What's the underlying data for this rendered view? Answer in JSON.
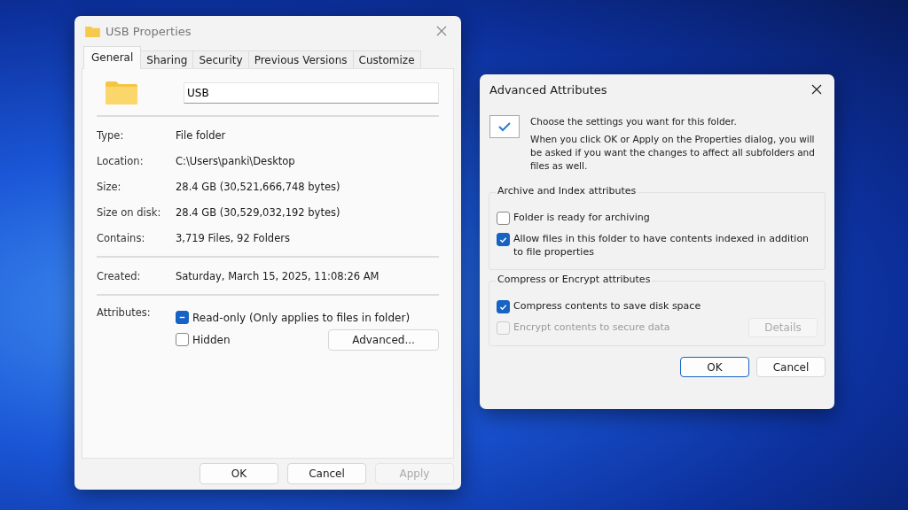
{
  "properties_window": {
    "title": "USB Properties",
    "tabs": [
      {
        "label": "General",
        "selected": true
      },
      {
        "label": "Sharing",
        "selected": false
      },
      {
        "label": "Security",
        "selected": false
      },
      {
        "label": "Previous Versions",
        "selected": false
      },
      {
        "label": "Customize",
        "selected": false
      }
    ],
    "name_field": {
      "value": "USB"
    },
    "info_groups": [
      [
        {
          "label": "Type:",
          "value": "File folder"
        },
        {
          "label": "Location:",
          "value": "C:\\Users\\panki\\Desktop"
        },
        {
          "label": "Size:",
          "value": "28.4 GB (30,521,666,748 bytes)"
        },
        {
          "label": "Size on disk:",
          "value": "28.4 GB (30,529,032,192 bytes)"
        },
        {
          "label": "Contains:",
          "value": "3,719 Files, 92 Folders"
        }
      ],
      [
        {
          "label": "Created:",
          "value": "Saturday, March 15, 2025, 11:08:26 AM"
        }
      ]
    ],
    "attributes": {
      "label": "Attributes:",
      "options": [
        {
          "label": "Read-only (Only applies to files in folder)",
          "checked": true,
          "mixed": true
        },
        {
          "label": "Hidden",
          "checked": false,
          "mixed": false
        }
      ],
      "advanced_button": "Advanced..."
    },
    "buttons": [
      {
        "label": "OK",
        "disabled": false
      },
      {
        "label": "Cancel",
        "disabled": false
      },
      {
        "label": "Apply",
        "disabled": true
      }
    ]
  },
  "advanced_window": {
    "title": "Advanced Attributes",
    "intro": "Choose the settings you want for this folder.",
    "note": "When you click OK or Apply on the Properties dialog, you will be asked if you want the changes to affect all subfolders and files as well.",
    "groups": [
      {
        "title": "Archive and Index attributes",
        "options": [
          {
            "label": "Folder is ready for archiving",
            "checked": false,
            "disabled": false
          },
          {
            "label": "Allow files in this folder to have contents indexed in addition to file properties",
            "checked": true,
            "disabled": false
          }
        ]
      },
      {
        "title": "Compress or Encrypt attributes",
        "options": [
          {
            "label": "Compress contents to save disk space",
            "checked": true,
            "disabled": false
          },
          {
            "label": "Encrypt contents to secure data",
            "checked": false,
            "disabled": true
          }
        ],
        "details_button": {
          "label": "Details",
          "disabled": true
        }
      }
    ],
    "buttons": [
      {
        "label": "OK",
        "default": true
      },
      {
        "label": "Cancel",
        "default": false
      }
    ]
  }
}
